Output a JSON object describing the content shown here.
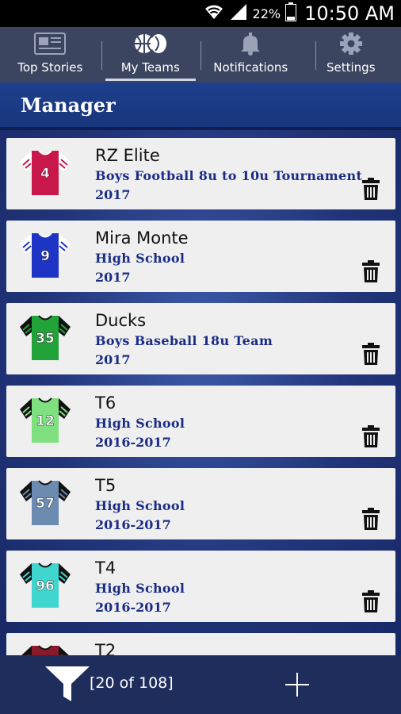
{
  "status": {
    "battery_pct": "22%",
    "time": "10:50 AM"
  },
  "tabs": [
    {
      "label": "Top Stories",
      "icon": "newspaper-icon"
    },
    {
      "label": "My Teams",
      "icon": "sports-balls-icon",
      "active": true
    },
    {
      "label": "Notifications",
      "icon": "bell-icon"
    },
    {
      "label": "Settings",
      "icon": "gear-icon"
    }
  ],
  "header": {
    "title": "Manager"
  },
  "teams": [
    {
      "name": "RZ Elite",
      "desc": "Boys Football 8u to 10u Tournament",
      "year": "2017",
      "number": "4",
      "body_color": "#c8174a",
      "sleeve_color": "#ffffff",
      "stripe_color": "#c8174a",
      "collar_color": "#ffffff"
    },
    {
      "name": "Mira Monte",
      "desc": "High School",
      "year": "2017",
      "number": "9",
      "body_color": "#1e34c4",
      "sleeve_color": "#ffffff",
      "stripe_color": "#1e34c4",
      "collar_color": "#ffffff"
    },
    {
      "name": "Ducks",
      "desc": "Boys Baseball 18u Team",
      "year": "2017",
      "number": "35",
      "body_color": "#22a33a",
      "sleeve_color": "#111111",
      "stripe_color": "#22a33a",
      "collar_color": "#111111"
    },
    {
      "name": "T6",
      "desc": "High School",
      "year": "2016-2017",
      "number": "12",
      "body_color": "#7fe07f",
      "sleeve_color": "#111111",
      "stripe_color": "#7fe07f",
      "collar_color": "#111111"
    },
    {
      "name": "T5",
      "desc": "High School",
      "year": "2016-2017",
      "number": "57",
      "body_color": "#6b8cb0",
      "sleeve_color": "#111111",
      "stripe_color": "#6b8cb0",
      "collar_color": "#111111"
    },
    {
      "name": "T4",
      "desc": "High School",
      "year": "2016-2017",
      "number": "96",
      "body_color": "#3fd6cf",
      "sleeve_color": "#111111",
      "stripe_color": "#3fd6cf",
      "collar_color": "#111111"
    },
    {
      "name": "T2",
      "desc": "",
      "year": "",
      "number": "",
      "body_color": "#8a1a2a",
      "sleeve_color": "#111111",
      "stripe_color": "#8a1a2a",
      "collar_color": "#111111"
    }
  ],
  "footer": {
    "count_text": "[20 of 108]"
  }
}
